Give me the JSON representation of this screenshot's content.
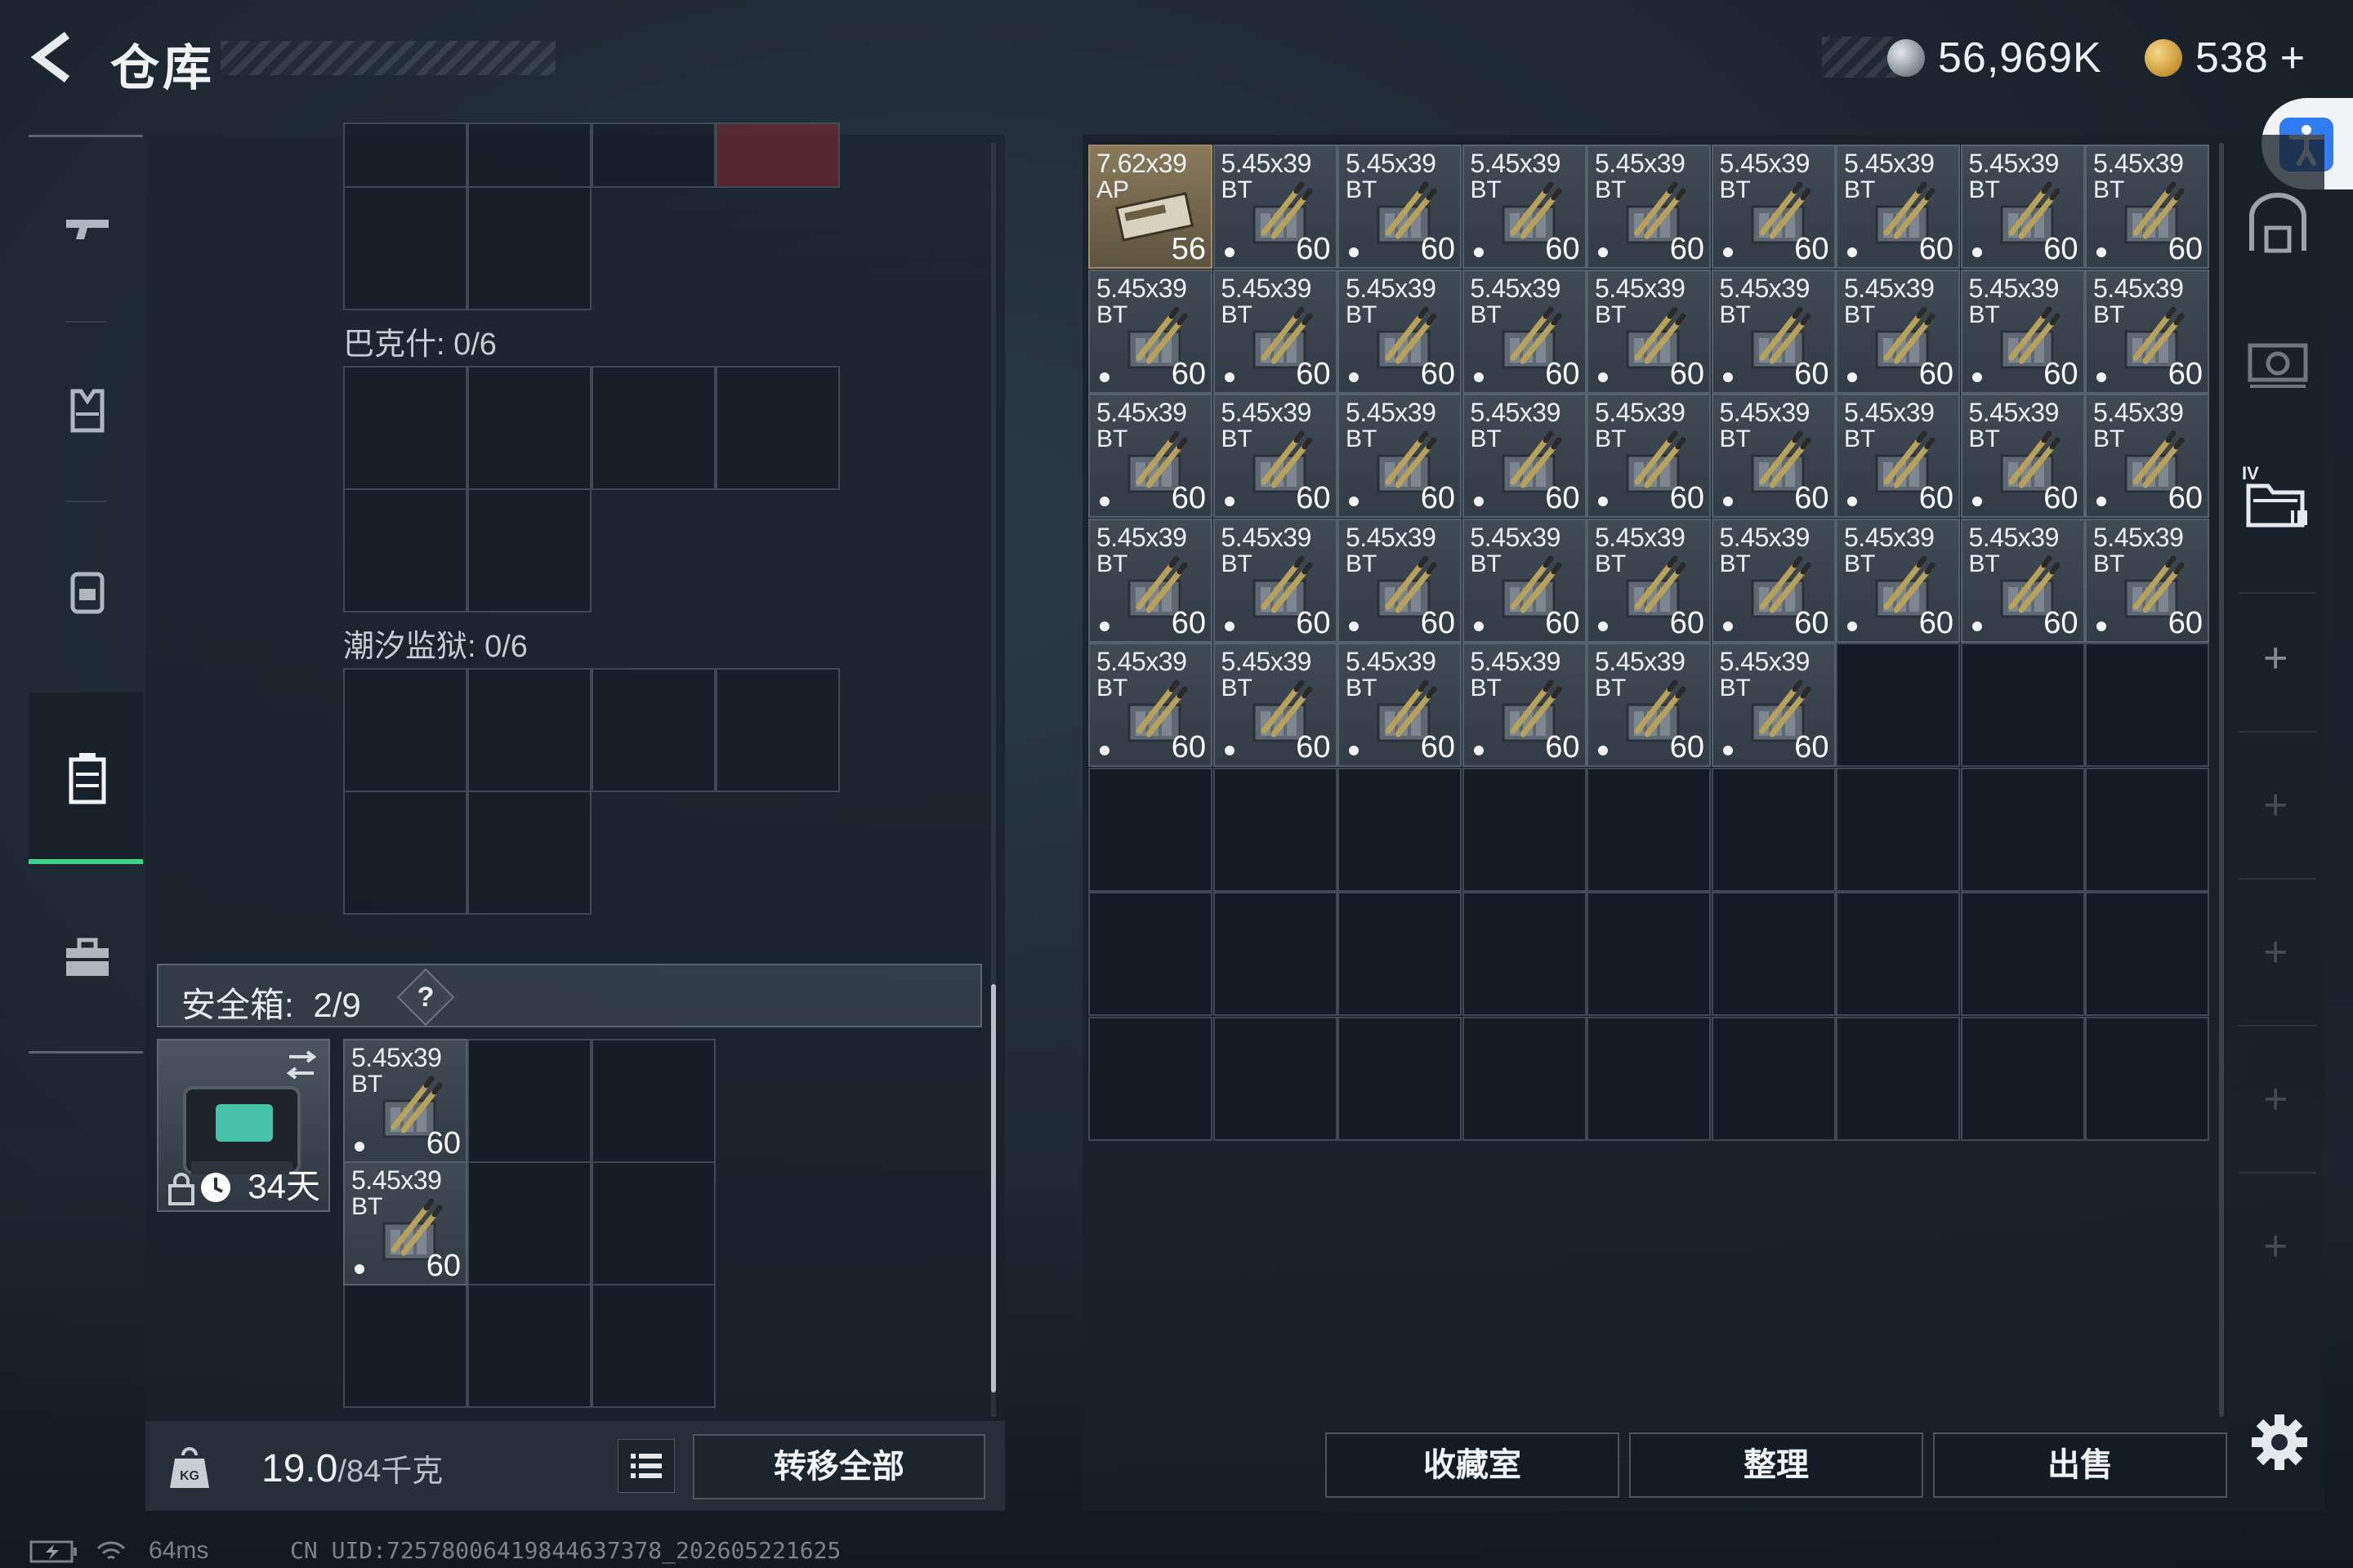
{
  "header": {
    "title": "仓库",
    "silver_amount": "56,969K",
    "gold_amount": "538",
    "gold_add": "+"
  },
  "left_nav": {
    "items": [
      "weapon-icon",
      "armor-vest-icon",
      "backpack-icon",
      "storage-case-icon",
      "briefcase-icon"
    ],
    "active": "storage-case-icon"
  },
  "containers": [
    {
      "label": "巴克什: 0/6"
    },
    {
      "label": "潮汐监狱: 0/6"
    }
  ],
  "safebox": {
    "label": "安全箱:",
    "count": "2/9",
    "help": "?",
    "days": "34天",
    "items": [
      {
        "caliber": "5.45x39",
        "type": "BT",
        "count": "60"
      },
      {
        "caliber": "5.45x39",
        "type": "BT",
        "count": "60"
      }
    ]
  },
  "weight": {
    "current": "19.0",
    "max": "/84千克"
  },
  "buttons": {
    "transfer_all": "转移全部",
    "collection": "收藏室",
    "organize": "整理",
    "sell": "出售"
  },
  "storage": {
    "first_item": {
      "caliber": "7.62x39",
      "type": "AP",
      "count": "56"
    },
    "bt_caliber": "5.45x39",
    "bt_type": "BT",
    "bt_count": "60",
    "bt_item_total": 41
  },
  "status": {
    "ping": "64ms",
    "uid": "CN UID:725780064198446373​78_202605221625"
  },
  "colors": {
    "active_green": "#3fd28a",
    "accessibility_blue": "#2f7df0",
    "ap_tile": "#8a7a5a"
  }
}
